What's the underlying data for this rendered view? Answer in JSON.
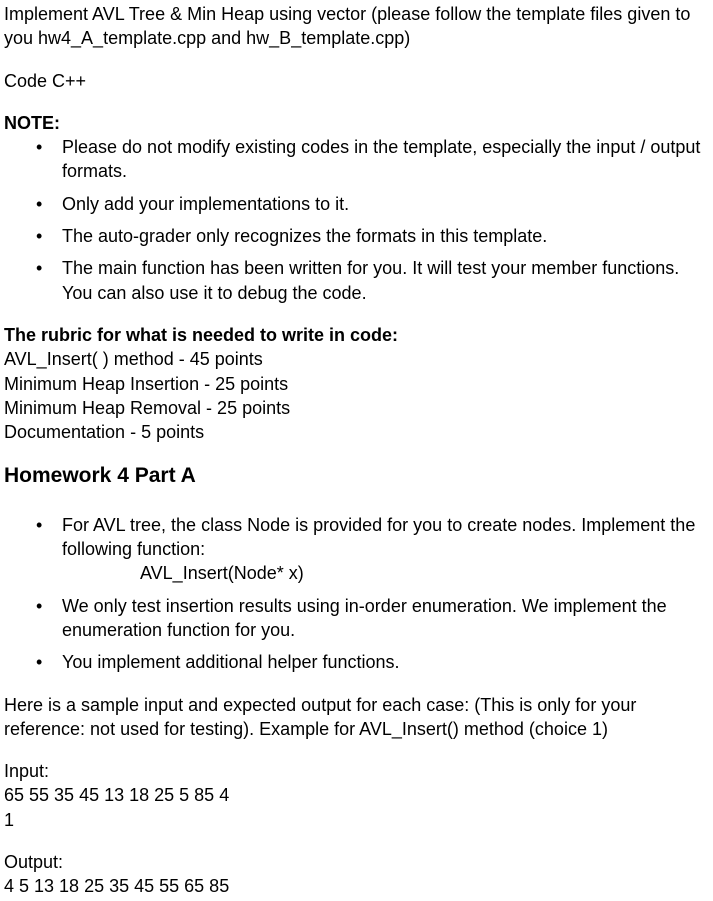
{
  "intro": {
    "line": "Implement AVL Tree & Min Heap using vector (please follow the template files given to you hw4_A_template.cpp and hw_B_template.cpp)"
  },
  "codeLang": "Code C++",
  "noteHeading": "NOTE:",
  "noteItems": [
    " Please do not modify existing codes in the template, especially the input / output formats.",
    "Only add your implementations to it.",
    "The auto-grader only recognizes the formats in this template.",
    "The main function has been written for you. It will test your member functions. You can also use it to debug the code."
  ],
  "rubricHeading": "The rubric for what is needed to write in code:",
  "rubricLines": [
    "AVL_Insert( ) method - 45 points",
    "Minimum Heap Insertion - 25 points",
    "Minimum Heap Removal - 25 points",
    "Documentation - 5 points"
  ],
  "partAHeading": "Homework 4 Part A",
  "partAItems": {
    "item1a": "For AVL tree, the class Node is provided for you to create nodes. Implement the following function:",
    "item1b": "AVL_Insert(Node* x)",
    "item2": "We only test insertion results using in-order enumeration. We implement the enumeration function for you.",
    "item3": "You implement additional helper functions."
  },
  "sampleIntro": "Here is a sample input and expected output for each case: (This is only for your reference: not used for testing). Example for AVL_Insert() method (choice 1)",
  "inputLabel": "Input:",
  "inputLines": [
    "65 55 35 45 13 18 25 5 85 4",
    "1"
  ],
  "outputLabel": "Output:",
  "outputLines": [
    "4 5 13 18 25 35 45 55 65 85"
  ]
}
